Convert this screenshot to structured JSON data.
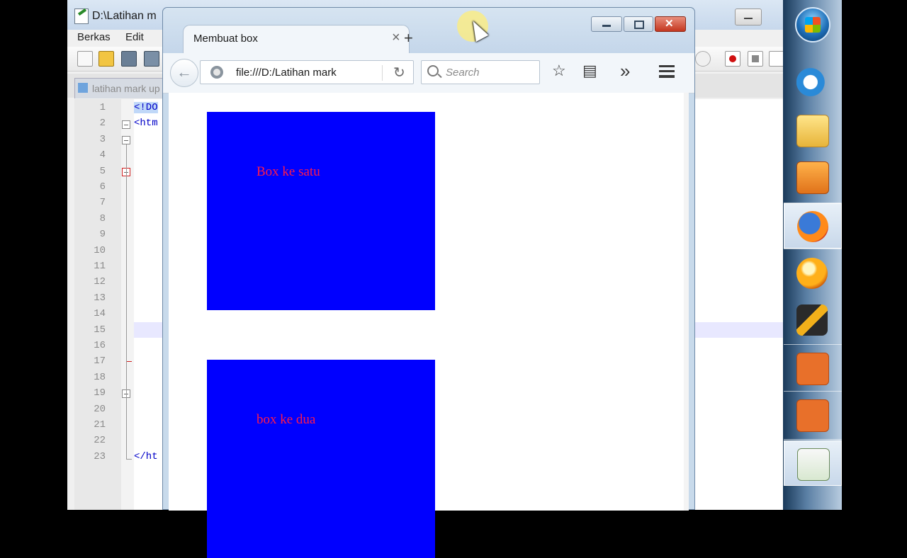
{
  "editor": {
    "title": "D:\\Latihan m",
    "menus": [
      "Berkas",
      "Edit"
    ],
    "tab_label": "latihan mark up",
    "line_numbers": [
      "1",
      "2",
      "3",
      "4",
      "5",
      "6",
      "7",
      "8",
      "9",
      "10",
      "11",
      "12",
      "13",
      "14",
      "15",
      "16",
      "17",
      "18",
      "19",
      "20",
      "21",
      "22",
      "23"
    ],
    "code_fragments": {
      "l1": "<!DO",
      "l2": "<htm",
      "l23": "</ht"
    }
  },
  "browser": {
    "tab_title": "Membuat box",
    "tab_close": "×",
    "new_tab": "+",
    "url": "file:///D:/Latihan mark",
    "search_placeholder": "Search",
    "overflow": "»",
    "back": "←",
    "reload": "↻",
    "bookmark": "☆",
    "library": "▤"
  },
  "page": {
    "box1_label": "Box ke satu",
    "box2_label": "box ke dua",
    "box_color": "#0000ff",
    "label_color": "#ff1a4a"
  },
  "taskbar": {
    "items": [
      "start-orb",
      "internet-explorer-icon",
      "file-explorer-icon",
      "media-player-icon",
      "firefox-icon",
      "cd-burner-icon",
      "winamp-icon",
      "screen-recorder-icon",
      "screenshot-icon",
      "notepadpp-icon"
    ]
  }
}
